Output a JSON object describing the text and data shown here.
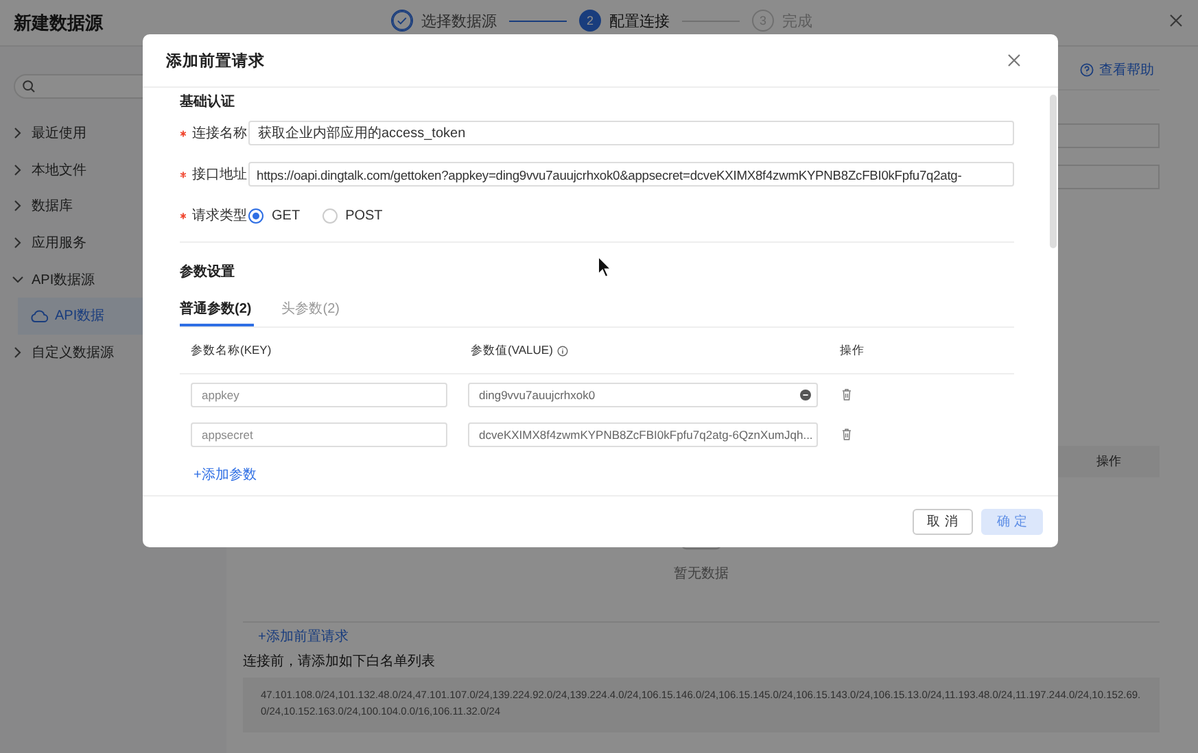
{
  "header": {
    "title": "新建数据源",
    "steps": [
      {
        "label": "选择数据源",
        "done": true,
        "active": false
      },
      {
        "number": "2",
        "label": "配置连接",
        "done": false,
        "active": true
      },
      {
        "number": "3",
        "label": "完成",
        "done": false,
        "active": false
      }
    ]
  },
  "sidebar": {
    "items": [
      {
        "label": "最近使用",
        "expanded": false,
        "selected": false
      },
      {
        "label": "本地文件",
        "expanded": false,
        "selected": false
      },
      {
        "label": "数据库",
        "expanded": false,
        "selected": false
      },
      {
        "label": "应用服务",
        "expanded": false,
        "selected": false
      },
      {
        "label": "API数据源",
        "expanded": true,
        "selected": false,
        "children": [
          {
            "label": "API数据",
            "selected": true
          }
        ]
      },
      {
        "label": "自定义数据源",
        "expanded": false,
        "selected": false
      }
    ]
  },
  "main": {
    "help_link": "查看帮助",
    "table": {
      "columns": [
        {
          "label": "操作"
        }
      ]
    },
    "empty_text": "暂无数据",
    "add_request_link": "+添加前置请求",
    "whitelist_note": "连接前，请添加如下白名单列表",
    "whitelist": "47.101.108.0/24,101.132.48.0/24,47.101.107.0/24,139.224.92.0/24,139.224.4.0/24,106.15.146.0/24,106.15.145.0/24,106.15.143.0/24,106.15.13.0/24,11.193.48.0/24,11.197.244.0/24,10.152.69.0/24,10.152.163.0/24,100.104.0.0/16,106.11.32.0/24"
  },
  "dialog": {
    "title": "添加前置请求",
    "basic_auth": {
      "heading": "基础认证",
      "fields": [
        {
          "label": "连接名称",
          "required": true,
          "value": "获取企业内部应用的access_token"
        },
        {
          "label": "接口地址",
          "required": true,
          "value": "https://oapi.dingtalk.com/gettoken?appkey=ding9vvu7auujcrhxok0&appsecret=dcveKXIMX8f4zwmKYPNB8ZcFBI0kFpfu7q2atg-"
        }
      ],
      "request_type": {
        "label": "请求类型",
        "required": true,
        "options": [
          {
            "label": "GET",
            "selected": true
          },
          {
            "label": "POST",
            "selected": false
          }
        ]
      }
    },
    "params": {
      "heading": "参数设置",
      "tabs": [
        {
          "label": "普通参数(2)",
          "selected": true
        },
        {
          "label": "头参数(2)",
          "selected": false
        }
      ],
      "columns": [
        {
          "label": "参数名称(KEY)",
          "info": false
        },
        {
          "label": "参数值(VALUE)",
          "info": true
        },
        {
          "label": "操作",
          "info": false
        }
      ],
      "rows": [
        {
          "key": "appkey",
          "value": "ding9vvu7auujcrhxok0"
        },
        {
          "key": "appsecret",
          "value": "dcveKXIMX8f4zwmKYPNB8ZcFBI0kFpfu7q2atg-6QznXumJqh..."
        }
      ],
      "add_link": "+添加参数"
    },
    "buttons": [
      {
        "label": "取 消",
        "kind": "default",
        "disabled": false
      },
      {
        "label": "确 定",
        "kind": "primary",
        "disabled": true
      }
    ]
  }
}
